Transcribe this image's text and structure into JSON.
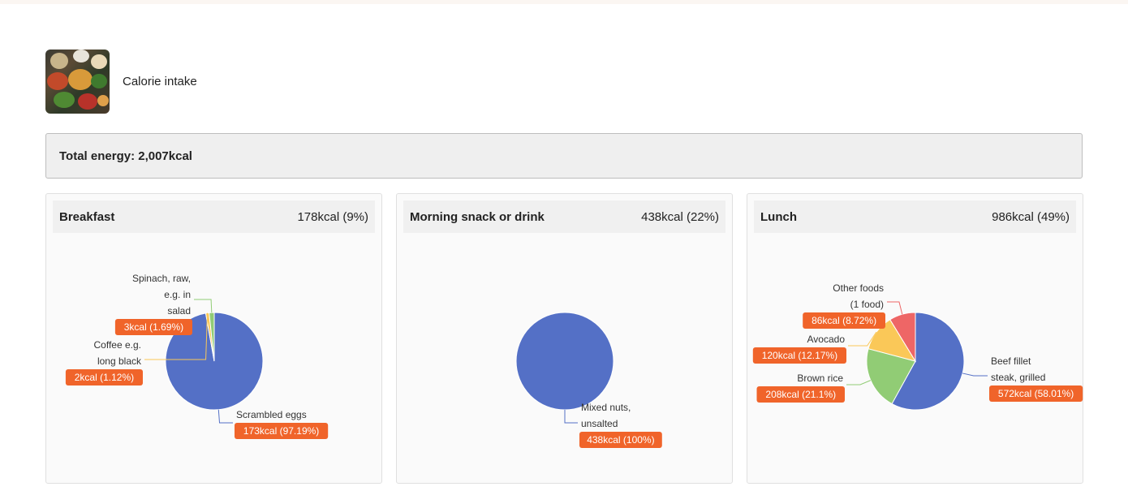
{
  "header": {
    "title": "Calorie intake",
    "image_icon": "food-photo-icon"
  },
  "total": {
    "text": "Total energy: 2,007kcal"
  },
  "colors": {
    "tag": "#f0642a",
    "blue": "#5470c6",
    "green": "#91cc75",
    "yellow": "#fac858",
    "red": "#ee6666"
  },
  "meals": [
    {
      "title": "Breakfast",
      "value": "178kcal (9%)"
    },
    {
      "title": "Morning snack or drink",
      "value": "438kcal (22%)"
    },
    {
      "title": "Lunch",
      "value": "986kcal (49%)"
    }
  ],
  "chart_data": [
    {
      "type": "pie",
      "title": "Breakfast",
      "slices": [
        {
          "name": "Scrambled eggs",
          "label_lines": [
            "Scrambled eggs"
          ],
          "kcal": 173,
          "tag": "173kcal (97.19%)",
          "color": "#5470c6"
        },
        {
          "name": "Coffee e.g. long black",
          "label_lines": [
            "Coffee e.g.",
            "long black"
          ],
          "kcal": 2,
          "tag": "2kcal (1.12%)",
          "color": "#fac858"
        },
        {
          "name": "Spinach, raw, e.g. in salad",
          "label_lines": [
            "Spinach, raw,",
            "e.g. in",
            "salad"
          ],
          "kcal": 3,
          "tag": "3kcal (1.69%)",
          "color": "#91cc75"
        }
      ]
    },
    {
      "type": "pie",
      "title": "Morning snack or drink",
      "slices": [
        {
          "name": "Mixed nuts, unsalted",
          "label_lines": [
            "Mixed nuts,",
            "unsalted"
          ],
          "kcal": 438,
          "tag": "438kcal (100%)",
          "color": "#5470c6"
        }
      ]
    },
    {
      "type": "pie",
      "title": "Lunch",
      "slices": [
        {
          "name": "Beef fillet steak, grilled",
          "label_lines": [
            "Beef fillet",
            "steak, grilled"
          ],
          "kcal": 572,
          "tag": "572kcal (58.01%)",
          "color": "#5470c6"
        },
        {
          "name": "Brown rice",
          "label_lines": [
            "Brown rice"
          ],
          "kcal": 208,
          "tag": "208kcal (21.1%)",
          "color": "#91cc75"
        },
        {
          "name": "Avocado",
          "label_lines": [
            "Avocado"
          ],
          "kcal": 120,
          "tag": "120kcal (12.17%)",
          "color": "#fac858"
        },
        {
          "name": "Other foods (1 food)",
          "label_lines": [
            "Other foods",
            "(1 food)"
          ],
          "kcal": 86,
          "tag": "86kcal (8.72%)",
          "color": "#ee6666"
        }
      ]
    }
  ]
}
